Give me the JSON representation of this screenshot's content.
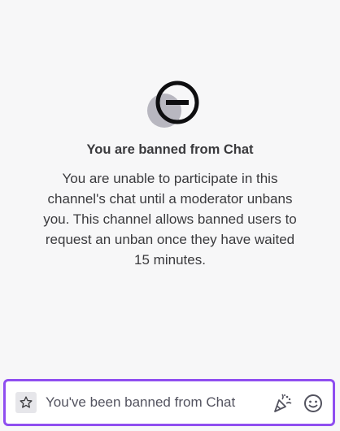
{
  "ban_notice": {
    "title": "You are banned from Chat",
    "message": "You are unable to participate in this channel's chat until a moderator unbans you. This channel allows banned users to request an unban once they have waited 15 minutes.",
    "icon": "ban-circle-icon"
  },
  "chat_input": {
    "placeholder": "You've been banned from Chat",
    "accent_color": "#8f4ef0",
    "left_button_icon": "star-icon",
    "right_icons": [
      "party-popper-icon",
      "smiley-face-icon"
    ]
  }
}
